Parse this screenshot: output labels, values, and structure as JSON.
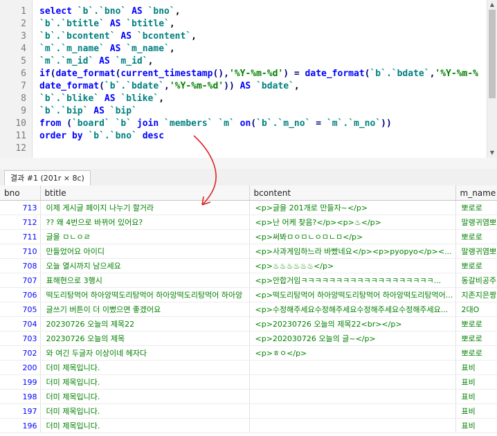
{
  "editor": {
    "line_numbers": [
      "1",
      "2",
      "3",
      "4",
      "5",
      "6",
      "7",
      "8",
      "9",
      "10",
      "11",
      "12"
    ]
  },
  "results": {
    "tab_label": "결과 #1 (201r × 8c)",
    "columns": [
      "bno",
      "btitle",
      "bcontent",
      "m_name"
    ],
    "rows": [
      {
        "bno": "713",
        "btitle": "이제 게시글 페이지 나누기 할거라",
        "bcontent": "<p>글을 201개로 만들자~</p>",
        "m_name": "뽀로로"
      },
      {
        "bno": "712",
        "btitle": "?? 왜 4번으로 바뀌어 있어요?",
        "bcontent": "<p>난 어케 찾음?</p><p>♨</p>",
        "m_name": "말랭귀염뽀"
      },
      {
        "bno": "711",
        "btitle": "글을 ㅁㄴㅇㄹ",
        "bcontent": "<p>써봐ㅁㅇㅁㄴㅇㅁㄴㅁ</p>",
        "m_name": "뽀로로"
      },
      {
        "bno": "710",
        "btitle": "만들었어요 아이디",
        "bcontent": "<p>사과게임하느라 바빴네요</p><p>pyopyo</p><...",
        "m_name": "말랭귀염뽀"
      },
      {
        "bno": "708",
        "btitle": "오늘 열시까지 남으세요",
        "bcontent": "<p>♨♨♨♨♨♨</p>",
        "m_name": "뽀로로"
      },
      {
        "bno": "707",
        "btitle": "표해현으로 3행시",
        "bcontent": "<p>안합거임ㅋㅋㅋㅋㅋㅋㅋㅋㅋㅋㅋㅋㅋㅋㅋㅋㅋㅋㅋ...",
        "m_name": "동갈비공주"
      },
      {
        "bno": "706",
        "btitle": "떡도리탕먹어 하아앙떡도리탕먹어 하아앙떡도리탕먹어 하아앙",
        "bcontent": "<p>떡도리탕먹어 하아앙떡도리탕먹어 하아앙떡도리탕먹어...",
        "m_name": "지존지은짱"
      },
      {
        "bno": "705",
        "btitle": "글쓰기 버튼이 더 이뻤으면 좋겠어요",
        "bcontent": "<p>수정해주세요수정해주세요수정해주세요수정해주세요...",
        "m_name": "2대O"
      },
      {
        "bno": "704",
        "btitle": "20230726 오늘의 제목22",
        "bcontent": "<p>20230726 오늘의 제목22<br></p>",
        "m_name": "뽀로로"
      },
      {
        "bno": "703",
        "btitle": "20230726 오늘의 제목",
        "bcontent": "<p>202030726 오늘의 글~</p>",
        "m_name": "뽀로로"
      },
      {
        "bno": "702",
        "btitle": "와 여긴 두글자 이상이네 헤자다",
        "bcontent": "<p>ㅎㅇ</p>",
        "m_name": "뽀로로"
      },
      {
        "bno": "200",
        "btitle": "더미 제목입니다.",
        "bcontent": "",
        "m_name": "표비"
      },
      {
        "bno": "199",
        "btitle": "더미 제목입니다.",
        "bcontent": "",
        "m_name": "표비"
      },
      {
        "bno": "198",
        "btitle": "더미 제목입니다.",
        "bcontent": "",
        "m_name": "표비"
      },
      {
        "bno": "197",
        "btitle": "더미 제목입니다.",
        "bcontent": "",
        "m_name": "표비"
      },
      {
        "bno": "196",
        "btitle": "더미 제목입니다.",
        "bcontent": "",
        "m_name": "표비"
      }
    ]
  },
  "colors": {
    "keyword": "#0000ff",
    "identifier": "#008080",
    "string": "#008000",
    "annotation_arrow": "#e02020"
  },
  "icons": {
    "arrow": "annotation-arrow",
    "scroll_up": "triangle-up",
    "scroll_down": "triangle-down"
  }
}
